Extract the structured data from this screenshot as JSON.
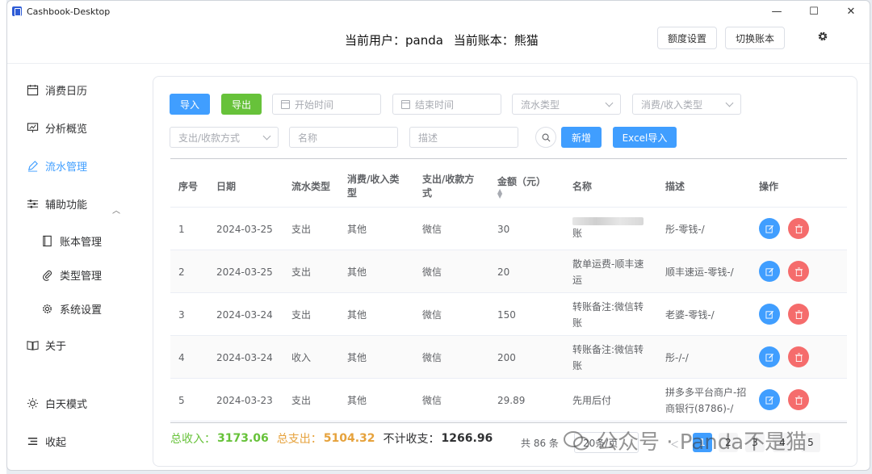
{
  "window": {
    "title": "Cashbook-Desktop",
    "minimize": "—",
    "maximize": "☐",
    "close": "✕"
  },
  "header": {
    "current_user_label": "当前用户：panda",
    "current_book_label": "当前账本：熊猫",
    "quota_button": "额度设置",
    "switch_book_button": "切换账本"
  },
  "sidebar": {
    "items": [
      {
        "label": "消费日历",
        "icon": "calendar-icon"
      },
      {
        "label": "分析概览",
        "icon": "chart-icon"
      },
      {
        "label": "流水管理",
        "icon": "pen-icon",
        "active": true
      },
      {
        "label": "辅助功能",
        "icon": "sliders-icon",
        "expanded": true
      },
      {
        "label": "账本管理",
        "icon": "book-icon"
      },
      {
        "label": "类型管理",
        "icon": "paperclip-icon"
      },
      {
        "label": "系统设置",
        "icon": "gear-icon"
      },
      {
        "label": "关于",
        "icon": "open-book-icon"
      },
      {
        "label": "白天模式",
        "icon": "sun-icon"
      },
      {
        "label": "收起",
        "icon": "menu-icon"
      }
    ]
  },
  "toolbar": {
    "import_button": "导入",
    "export_button": "导出",
    "start_date_placeholder": "开始时间",
    "end_date_placeholder": "结束时间",
    "flow_type_placeholder": "流水类型",
    "income_type_placeholder": "消费/收入类型",
    "pay_method_placeholder": "支出/收款方式",
    "name_placeholder": "名称",
    "desc_placeholder": "描述",
    "add_button": "新增",
    "excel_import_button": "Excel导入"
  },
  "table": {
    "columns": [
      "序号",
      "日期",
      "流水类型",
      "消费/收入类\n型",
      "支出/收款方\n式",
      "金额（元）",
      "名称",
      "描述",
      "操作"
    ],
    "rows": [
      {
        "no": "1",
        "date": "2024-03-25",
        "flow": "支出",
        "type": "其他",
        "method": "微信",
        "amount": "30",
        "name": "账",
        "desc": "彤-零钱-/"
      },
      {
        "no": "2",
        "date": "2024-03-25",
        "flow": "支出",
        "type": "其他",
        "method": "微信",
        "amount": "20",
        "name": "散单运费-顺丰速运",
        "desc": "顺丰速运-零钱-/"
      },
      {
        "no": "3",
        "date": "2024-03-24",
        "flow": "支出",
        "type": "其他",
        "method": "微信",
        "amount": "150",
        "name": "转账备注:微信转账",
        "desc": "老婆-零钱-/"
      },
      {
        "no": "4",
        "date": "2024-03-24",
        "flow": "收入",
        "type": "其他",
        "method": "微信",
        "amount": "200",
        "name": "转账备注:微信转账",
        "desc": "彤-/-/"
      },
      {
        "no": "5",
        "date": "2024-03-23",
        "flow": "支出",
        "type": "其他",
        "method": "微信",
        "amount": "29.89",
        "name": "先用后付",
        "desc": "拼多多平台商户-招商银行(8786)-/"
      }
    ]
  },
  "summary": {
    "income_label": "总收入：",
    "income_value": "3173.06",
    "expense_label": "总支出：",
    "expense_value": "5104.32",
    "excluded_label": "不计收支：",
    "excluded_value": "1266.96"
  },
  "pagination": {
    "total": "共 86 条",
    "page_size": "20条/页",
    "pages": [
      "1",
      "2",
      "3",
      "4",
      "5"
    ],
    "current": "1"
  },
  "watermark": {
    "text": "公众号 · Panda不是猫"
  },
  "colors": {
    "primary": "#409eff",
    "success": "#67c23a",
    "warning": "#e6a23c",
    "danger": "#f56c6c"
  }
}
